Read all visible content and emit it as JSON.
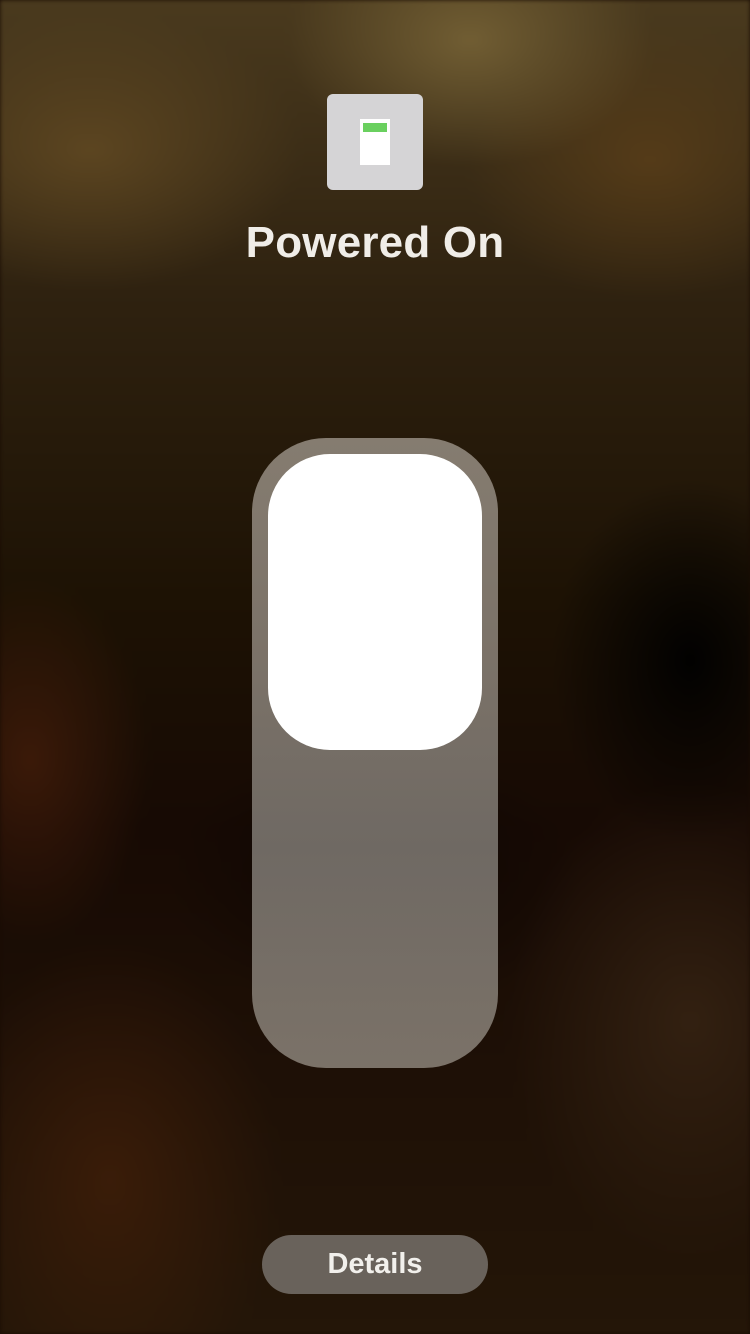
{
  "accessory": {
    "icon": "smart-plug-icon",
    "status_text": "Powered On",
    "indicator_color": "#6ad05f",
    "toggle": {
      "state": "on"
    }
  },
  "footer": {
    "details_label": "Details"
  }
}
